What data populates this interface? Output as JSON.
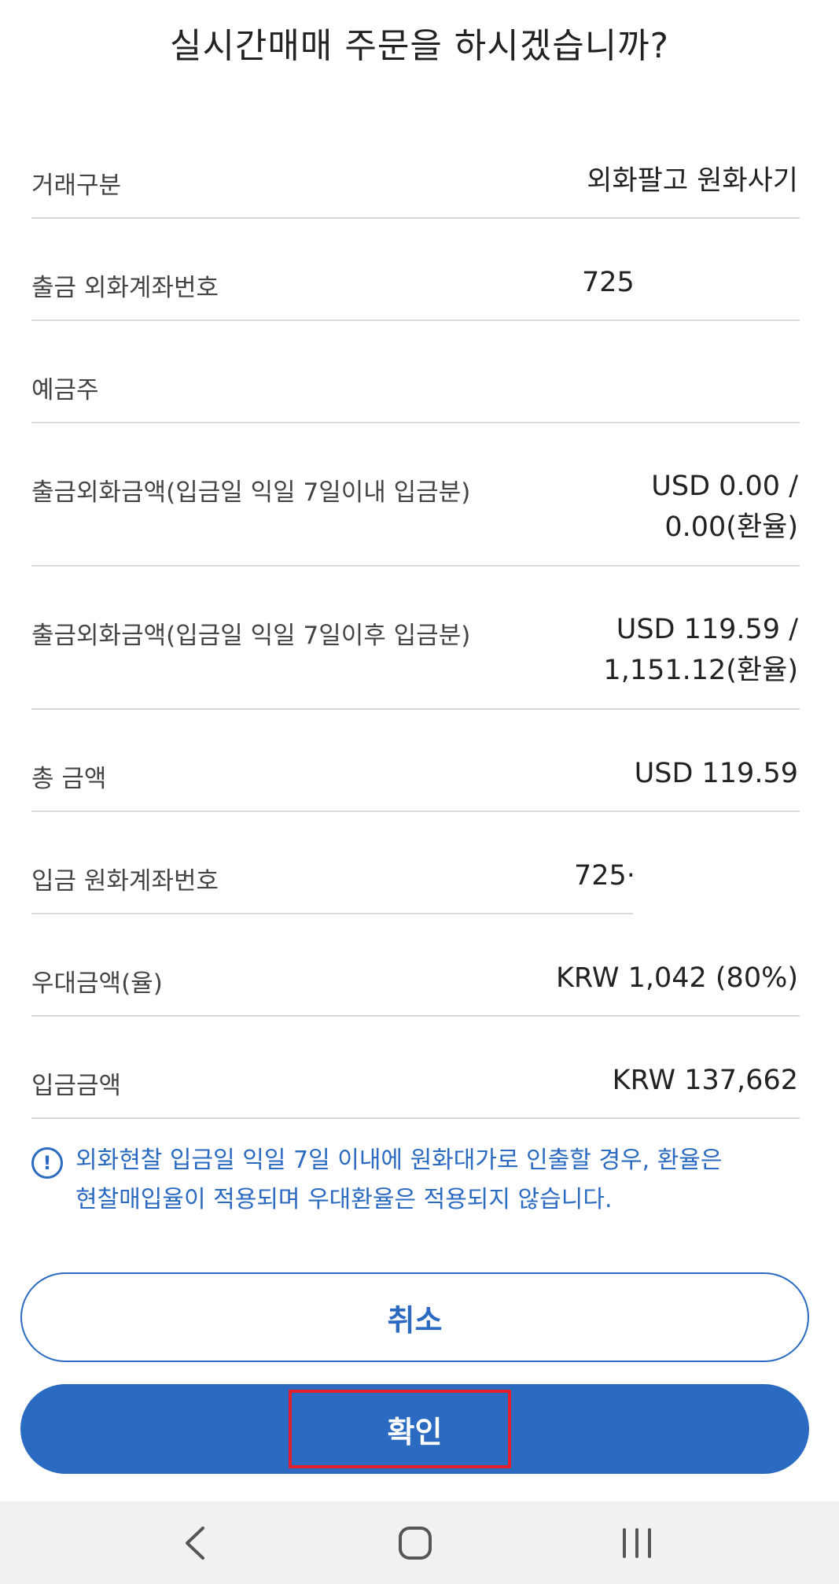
{
  "dialog": {
    "title": "실시간매매 주문을 하시겠습니까?"
  },
  "rows": [
    {
      "label": "거래구분",
      "value": "외화팔고 원화사기"
    },
    {
      "label": "출금 외화계좌번호",
      "value": "725"
    },
    {
      "label": "예금주",
      "value": ""
    },
    {
      "label": "출금외화금액(입금일 익일 7일이내 입금분)",
      "value_line1": "USD 0.00 /",
      "value_line2": "0.00(환율)"
    },
    {
      "label": "출금외화금액(입금일 익일 7일이후 입금분)",
      "value_line1": "USD 119.59 /",
      "value_line2": "1,151.12(환율)"
    },
    {
      "label": "총 금액",
      "value": "USD 119.59"
    },
    {
      "label": "입금 원화계좌번호",
      "value": "725·"
    },
    {
      "label": "우대금액(율)",
      "value": "KRW 1,042 (80%)"
    },
    {
      "label": "입금금액",
      "value": "KRW 137,662"
    }
  ],
  "notice": {
    "icon": "exclamation-circle-icon",
    "text_line1": "외화현찰 입금일 익일 7일 이내에 원화대가로 인출할 경우, 환율은",
    "text_line2": "현찰매입율이 적용되며 우대환율은 적용되지 않습니다."
  },
  "buttons": {
    "cancel_label": "취소",
    "confirm_label": "확인"
  },
  "navbar": {
    "back_icon": "back-chevron-icon",
    "home_icon": "home-icon",
    "recents_icon": "recent-apps-icon"
  },
  "colors": {
    "accent": "#2a6ac0",
    "highlight": "#e0202a",
    "divider": "#d9d9d9",
    "navbar_bg": "#f1f1f1"
  }
}
